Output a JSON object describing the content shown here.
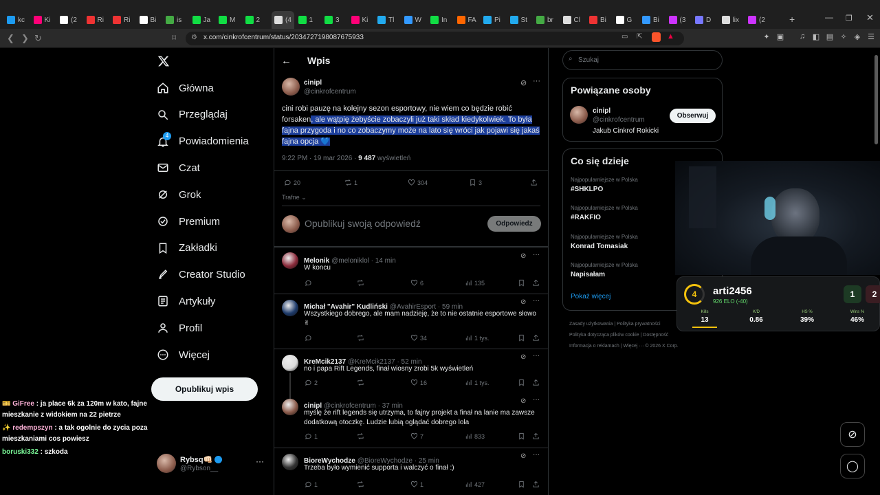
{
  "browser": {
    "tabs": [
      "kc",
      "Ki",
      "(2",
      "Ri",
      "Ri",
      "Bi",
      "is",
      "Ja",
      "M",
      "2",
      "(4",
      "1",
      "3",
      "Ki",
      "Tl",
      "W",
      "In",
      "FA",
      "Pi",
      "St",
      "br",
      "Cl",
      "Bi",
      "G",
      "Bi",
      "(3",
      "D",
      "lix",
      "(2"
    ],
    "active_tab_label": "(4",
    "url": "x.com/cinkrofcentrum/status/2034727198087675933"
  },
  "sidebar": {
    "items": [
      {
        "label": "Główna",
        "icon": "home-icon"
      },
      {
        "label": "Przeglądaj",
        "icon": "search-icon"
      },
      {
        "label": "Powiadomienia",
        "icon": "bell-icon",
        "badge": "4"
      },
      {
        "label": "Czat",
        "icon": "mail-icon"
      },
      {
        "label": "Grok",
        "icon": "grok-icon"
      },
      {
        "label": "Premium",
        "icon": "premium-icon"
      },
      {
        "label": "Zakładki",
        "icon": "bookmark-icon"
      },
      {
        "label": "Creator Studio",
        "icon": "rocket-icon"
      },
      {
        "label": "Artykuły",
        "icon": "article-icon"
      },
      {
        "label": "Profil",
        "icon": "profile-icon"
      },
      {
        "label": "Więcej",
        "icon": "more-circle-icon"
      }
    ],
    "post_button": "Opublikuj wpis",
    "account": {
      "name": "Rybsq",
      "emoji": "👊🏻",
      "handle": "@Rybson__"
    }
  },
  "header": {
    "title": "Wpis"
  },
  "post": {
    "author": "cinipl",
    "handle": "@cinkrofcentrum",
    "text_plain": "cini robi pauzę na kolejny sezon esportowy, nie wiem co będzie robić forsaken",
    "text_selected": ", ale wątpię żebyście zobaczyli już taki skład kiedykolwiek. To była fajna przygoda i no co zobaczymy może na lato się wróci jak pojawi się jakaś fajna opcja 💙",
    "time": "9:22 PM · 19 mar 2026 · ",
    "views": "9 487",
    "views_label": " wyświetleń",
    "replies": "20",
    "reposts": "1",
    "likes": "304",
    "bookmarks": "3",
    "sort": "Trafne"
  },
  "composer": {
    "placeholder": "Opublikuj swoją odpowiedź",
    "button": "Odpowiedz"
  },
  "replies": [
    {
      "name": "Melonik",
      "handle": "@meloniklol · 14 min",
      "text": "W koncu",
      "replies": "",
      "reposts": "",
      "likes": "6",
      "views": "135"
    },
    {
      "name": "Michał \"Avahir\" Kudliński",
      "handle": "@AvahirEsport · 59 min",
      "text": "Wszystkiego dobrego, ale mam nadzieję, że to nie ostatnie esportowe słowo ✌",
      "replies": "",
      "reposts": "",
      "likes": "34",
      "views": "1 tys."
    },
    {
      "name": "KreMcik2137",
      "handle": "@KreMcik2137 · 52 min",
      "text": "no i papa Rift Legends, finał wiosny zrobi 5k wyświetleń",
      "replies": "2",
      "reposts": "",
      "likes": "16",
      "views": "1 tys."
    },
    {
      "name": "cinipl",
      "handle": "@cinkrofcentrum · 37 min",
      "text": "myślę że rift legends się utrzyma, to fajny projekt a finał na lanie ma zawsze dodatkową otoczkę. Ludzie lubią oglądać dobrego lola",
      "replies": "1",
      "reposts": "",
      "likes": "7",
      "views": "833"
    },
    {
      "name": "BioreWychodze",
      "handle": "@BioreWychodze · 25 min",
      "text": "Trzeba było wymienić supporta i walczyć o finał :)",
      "replies": "1",
      "reposts": "",
      "likes": "1",
      "views": "427"
    }
  ],
  "search": {
    "placeholder": "Szukaj"
  },
  "related": {
    "title": "Powiązane osoby",
    "name": "cinipl",
    "handle": "@cinkrofcentrum",
    "bio": "Jakub Cinkrof Rokicki",
    "follow": "Obserwuj"
  },
  "trends": {
    "title": "Co się dzieje",
    "items": [
      {
        "context": "Najpopularniejsze w Polska",
        "name": "#SHKLPO"
      },
      {
        "context": "Najpopularniejsze w Polska",
        "name": "#RAKFIO"
      },
      {
        "context": "Najpopularniejsze w Polska",
        "name": "Konrad Tomasiak"
      },
      {
        "context": "Najpopularniejsze w Polska",
        "name": "Napisałam"
      }
    ],
    "more": "Pokaż więcej"
  },
  "footer": [
    "Zasady użytkowania",
    "Polityka prywatności",
    "Polityka dotycząca plików cookie",
    "Dostępność",
    "Informacja o reklamach",
    "Więcej ···",
    "© 2026 X Corp."
  ],
  "stream": {
    "player": "arti2456",
    "level": "4",
    "elo": "926 ELO (-40)",
    "score_a": "1",
    "score_b": "2",
    "stats": [
      {
        "label": "Kills",
        "value": "13"
      },
      {
        "label": "K/D",
        "value": "0.86"
      },
      {
        "label": "HS %",
        "value": "39%"
      },
      {
        "label": "Wins %",
        "value": "46%"
      }
    ],
    "chat": [
      {
        "user": "GiFree",
        "text": " : ja place 6k za 120m w kato, fajne mieszkanie z widokiem na 22 pietrze",
        "color": "#ffb3d9"
      },
      {
        "user": "redempszyn",
        "text": " : a tak ogolnie do zycia poza mieszkaniami cos powiesz",
        "color": "#ffb3d9"
      },
      {
        "user": "boruski332",
        "text": " : szkoda",
        "color": "#7CFC9A"
      }
    ]
  },
  "colors": {
    "accent": "#1d9bf0",
    "selection": "#1d3f9c",
    "bg": "#000000",
    "border": "#2f3336"
  }
}
